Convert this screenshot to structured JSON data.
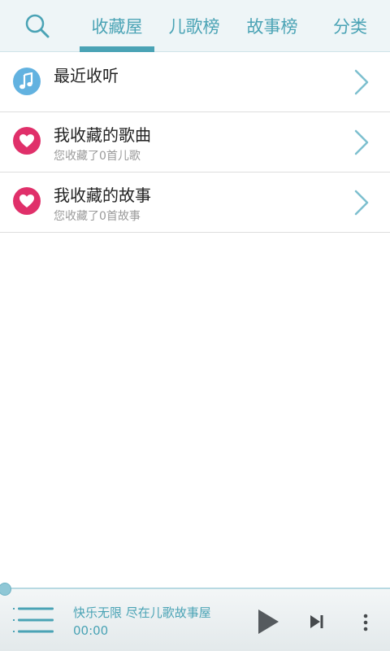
{
  "tabs": [
    {
      "label": "收藏屋",
      "active": true
    },
    {
      "label": "儿歌榜",
      "active": false
    },
    {
      "label": "故事榜",
      "active": false
    },
    {
      "label": "分类",
      "active": false
    }
  ],
  "list": [
    {
      "title": "最近收听",
      "subtitle": "",
      "icon": "music-note-icon"
    },
    {
      "title": "我收藏的歌曲",
      "subtitle": "您收藏了0首儿歌",
      "icon": "heart-icon"
    },
    {
      "title": "我收藏的故事",
      "subtitle": "您收藏了0首故事",
      "icon": "heart-icon"
    }
  ],
  "player": {
    "track_title": "快乐无限 尽在儿歌故事屋",
    "time": "00:00",
    "progress": 0
  },
  "colors": {
    "accent": "#4aa3b5",
    "music_icon_bg": "#62b2e0",
    "heart_icon_bg": "#e0306a"
  }
}
